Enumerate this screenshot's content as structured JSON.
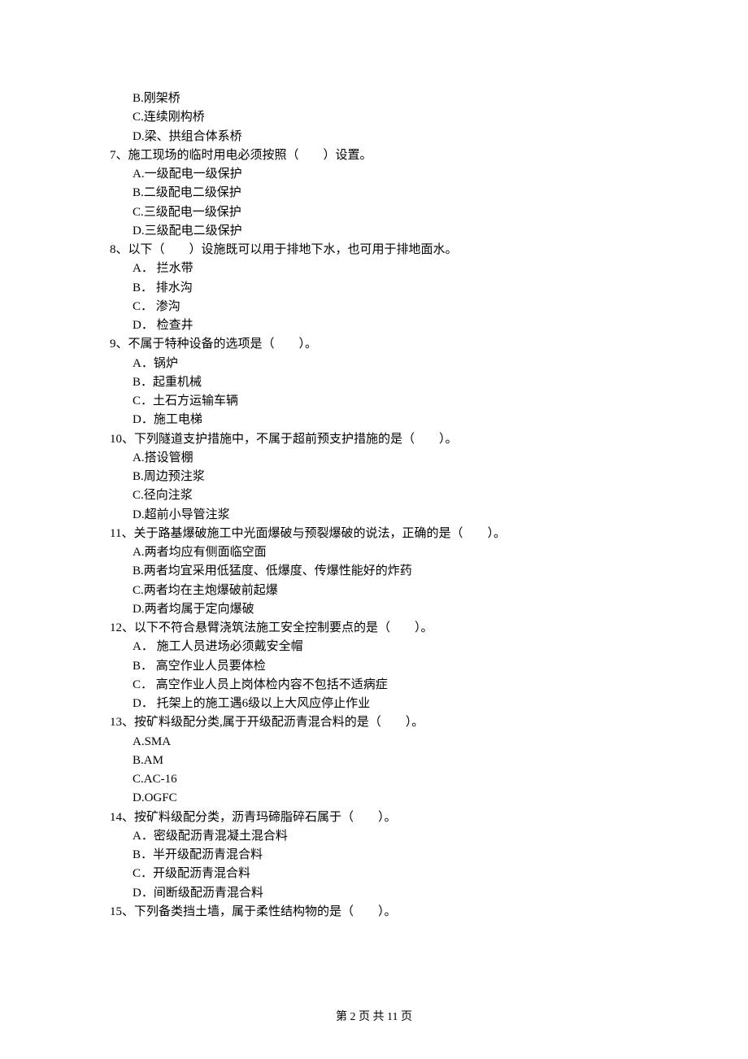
{
  "lines": [
    {
      "cls": "option-line",
      "text": "B.刚架桥"
    },
    {
      "cls": "option-line",
      "text": "C.连续刚构桥"
    },
    {
      "cls": "option-line",
      "text": "D.梁、拱组合体系桥"
    },
    {
      "cls": "question-line",
      "text": "7、施工现场的临时用电必须按照（　　）设置。"
    },
    {
      "cls": "option-line",
      "text": "A.一级配电一级保护"
    },
    {
      "cls": "option-line",
      "text": "B.二级配电二级保护"
    },
    {
      "cls": "option-line",
      "text": "C.三级配电一级保护"
    },
    {
      "cls": "option-line",
      "text": "D.三级配电二级保护"
    },
    {
      "cls": "question-line",
      "text": "8、以下（　　）设施既可以用于排地下水，也可用于排地面水。"
    },
    {
      "cls": "option-line",
      "text": "A． 拦水带"
    },
    {
      "cls": "option-line",
      "text": "B． 排水沟"
    },
    {
      "cls": "option-line",
      "text": "C． 渗沟"
    },
    {
      "cls": "option-line",
      "text": "D． 检查井"
    },
    {
      "cls": "question-line",
      "text": "9、不属于特种设备的选项是（　　）。"
    },
    {
      "cls": "option-line",
      "text": "A．锅炉"
    },
    {
      "cls": "option-line",
      "text": "B．起重机械"
    },
    {
      "cls": "option-line",
      "text": "C．土石方运输车辆"
    },
    {
      "cls": "option-line",
      "text": "D．施工电梯"
    },
    {
      "cls": "question-line",
      "text": "10、下列隧道支护措施中，不属于超前预支护措施的是（　　）。"
    },
    {
      "cls": "option-line",
      "text": "A.搭设管棚"
    },
    {
      "cls": "option-line",
      "text": "B.周边预注浆"
    },
    {
      "cls": "option-line",
      "text": "C.径向注浆"
    },
    {
      "cls": "option-line",
      "text": "D.超前小导管注浆"
    },
    {
      "cls": "question-line",
      "text": "11、关于路基爆破施工中光面爆破与预裂爆破的说法，正确的是（　　）。"
    },
    {
      "cls": "option-line",
      "text": "A.两者均应有侧面临空面"
    },
    {
      "cls": "option-line",
      "text": "B.两者均宜采用低猛度、低爆度、传爆性能好的炸药"
    },
    {
      "cls": "option-line",
      "text": "C.两者均在主炮爆破前起爆"
    },
    {
      "cls": "option-line",
      "text": "D.两者均属于定向爆破"
    },
    {
      "cls": "question-line",
      "text": "12、以下不符合悬臂浇筑法施工安全控制要点的是（　　）。"
    },
    {
      "cls": "option-line",
      "text": "A． 施工人员进场必须戴安全帽"
    },
    {
      "cls": "option-line",
      "text": "B． 高空作业人员要体检"
    },
    {
      "cls": "option-line",
      "text": "C． 高空作业人员上岗体检内容不包括不适病症"
    },
    {
      "cls": "option-line",
      "text": "D． 托架上的施工遇6级以上大风应停止作业"
    },
    {
      "cls": "question-line",
      "text": "13、按矿料级配分类,属于开级配沥青混合料的是（　　）。"
    },
    {
      "cls": "option-line",
      "text": "A.SMA"
    },
    {
      "cls": "option-line",
      "text": "B.AM"
    },
    {
      "cls": "option-line",
      "text": "C.AC-16"
    },
    {
      "cls": "option-line",
      "text": "D.OGFC"
    },
    {
      "cls": "question-line",
      "text": "14、按矿料级配分类，沥青玛碲脂碎石属于（　　）。"
    },
    {
      "cls": "option-line",
      "text": "A．密级配沥青混凝土混合料"
    },
    {
      "cls": "option-line",
      "text": "B．半开级配沥青混合料"
    },
    {
      "cls": "option-line",
      "text": "C．开级配沥青混合料"
    },
    {
      "cls": "option-line",
      "text": "D．间断级配沥青混合料"
    },
    {
      "cls": "question-line",
      "text": "15、下列备类挡土墙，属于柔性结构物的是（　　）。"
    }
  ],
  "footer": "第 2 页 共 11 页"
}
